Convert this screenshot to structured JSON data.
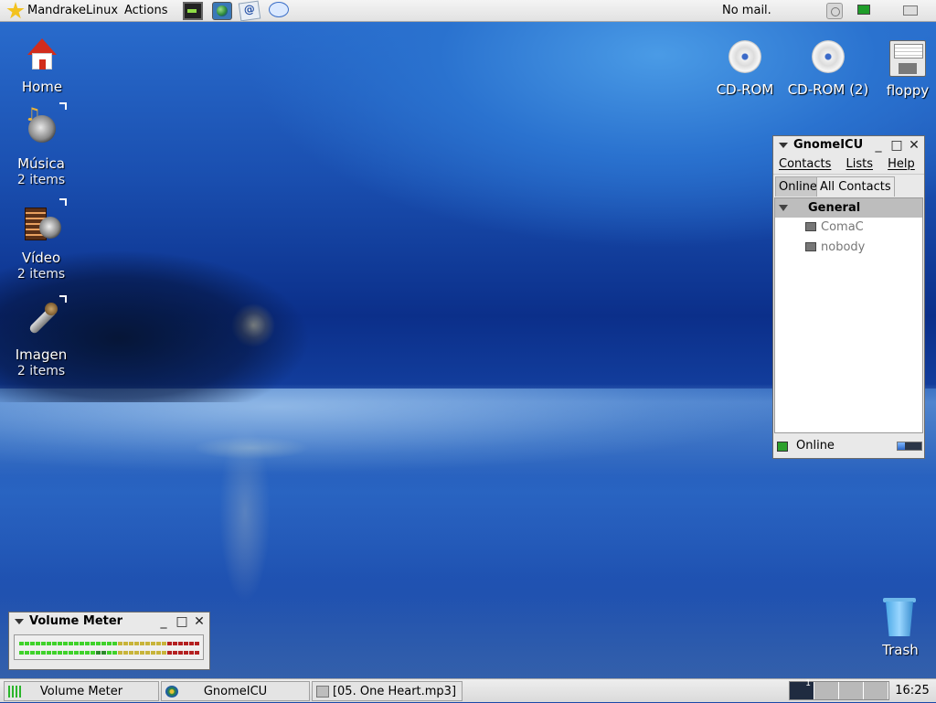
{
  "top_panel": {
    "menu_main": "MandrakeLinux",
    "menu_actions": "Actions",
    "mail_status": "No mail."
  },
  "desktop": {
    "left_icons": [
      {
        "label": "Home",
        "sub": ""
      },
      {
        "label": "Música",
        "sub": "2 items"
      },
      {
        "label": "Vídeo",
        "sub": "2 items"
      },
      {
        "label": "Imagen",
        "sub": "2 items"
      }
    ],
    "right_icons": [
      {
        "label": "CD-ROM"
      },
      {
        "label": "CD-ROM (2)"
      },
      {
        "label": "floppy"
      }
    ],
    "trash": "Trash"
  },
  "gnomeicu": {
    "title": "GnomeICU",
    "menu": [
      "Contacts",
      "Lists",
      "Help"
    ],
    "tabs": [
      "Online",
      "All Contacts"
    ],
    "group": "General",
    "contacts": [
      "ComaC",
      "nobody"
    ],
    "status": "Online"
  },
  "volume_meter": {
    "title": "Volume Meter"
  },
  "taskbar": {
    "tasks": [
      "Volume Meter",
      "GnomeICU",
      "[05. One Heart.mp3]"
    ],
    "clock": "16:25",
    "pager_active_label": "1"
  },
  "colors": {
    "status_online": "#2ca02c",
    "meter_green": "#3fd22a",
    "meter_yellow": "#c8b43a",
    "meter_red": "#b42020"
  }
}
